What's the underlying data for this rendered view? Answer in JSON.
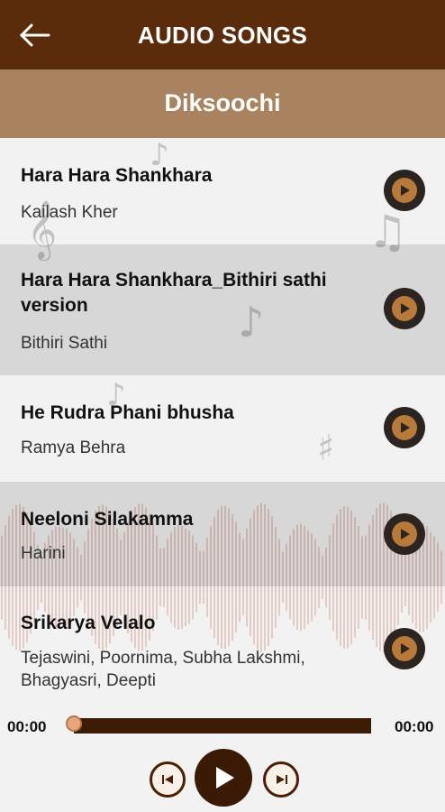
{
  "appbar": {
    "title": "AUDIO SONGS",
    "back_icon": "arrow-left-icon"
  },
  "album": {
    "title": "Diksoochi"
  },
  "songs": [
    {
      "title": "Hara Hara Shankhara",
      "artist": "Kailash Kher",
      "icon": "play-icon"
    },
    {
      "title": "Hara Hara Shankhara_Bithiri sathi version",
      "artist": "Bithiri Sathi",
      "icon": "play-icon"
    },
    {
      "title": "He Rudra Phani bhusha",
      "artist": "Ramya Behra",
      "icon": "play-icon"
    },
    {
      "title": "Neeloni Silakamma",
      "artist": "Harini",
      "icon": "play-icon"
    },
    {
      "title": "Srikarya Velalo",
      "artist": "Tejaswini, Poornima, Subha Lakshmi, Bhagyasri, Deepti",
      "icon": "play-icon"
    }
  ],
  "player": {
    "elapsed": "00:00",
    "duration": "00:00",
    "progress": 0,
    "controls": {
      "previous": "previous-icon",
      "play": "play-icon",
      "next": "next-icon"
    }
  },
  "colors": {
    "appbar": "#5a2c0c",
    "subheader": "#a9835f",
    "accent": "#b77a3a",
    "seek_bar": "#3c1c06"
  }
}
